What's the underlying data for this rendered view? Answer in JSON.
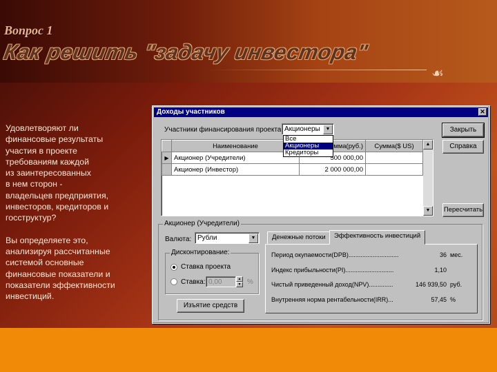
{
  "slide": {
    "pretitle": "Вопрос 1",
    "title": "Как решить \"задачу инвестора\"",
    "ornament": "☙",
    "paragraph1": "Удовлетворяют ли\nфинансовые результаты\nучастия в проекте\nтребованиям каждой\nиз заинтересованных\nв нем сторон -\nвладельцев предприятия,\nинвесторов, кредиторов и\nгосструктур?",
    "paragraph2": "Вы определяете это,\nанализируя рассчитанные\nсистемой основные\nфинансовые показатели и\nпоказатели эффективности\nинвестиций."
  },
  "dialog": {
    "title": "Доходы участников",
    "close_icon": "✕",
    "participants_label": "Участники финансирования проекта:",
    "participants_value": "Акционеры",
    "dropdown_options": [
      "Все",
      "Акционеры",
      "Кредиторы"
    ],
    "dropdown_selected": 1,
    "buttons": {
      "close": "Закрыть",
      "help": "Справка",
      "recalc": "Пересчитать",
      "withdraw": "Изъятие средств"
    },
    "table": {
      "headers": [
        "Наименование",
        "Сумма(руб.)",
        "Сумма($ US)"
      ],
      "rows": [
        {
          "name": "Акционер (Учредители)",
          "rub": "500 000,00",
          "usd": ""
        },
        {
          "name": "Акционер (Инвестор)",
          "rub": "2 000 000,00",
          "usd": ""
        }
      ]
    },
    "group_title": "Акционер (Учредители)",
    "currency_label": "Валюта:",
    "currency_value": "Рубли",
    "discount": {
      "title": "Дисконтирование:",
      "option1": "Ставка проекта",
      "option2": "Ставка:",
      "rate_value": "0,00",
      "rate_unit": "%"
    },
    "tabs": [
      "Денежные потоки",
      "Эффективность инвестиций"
    ],
    "active_tab": 1,
    "metrics": [
      {
        "label": "Период окупаемости(DPB).............................",
        "value": "36",
        "unit": "мес."
      },
      {
        "label": "Индекс прибыльности(PI)............................",
        "value": "1,10",
        "unit": ""
      },
      {
        "label": "Чистый приведенный доход(NPV)..............",
        "value": "146 939,50",
        "unit": "руб."
      },
      {
        "label": "Внутренняя норма рентабельности(IRR)...",
        "value": "57,45",
        "unit": "%"
      }
    ]
  },
  "colors": {
    "accent_band": "#f18a07",
    "title_bar": "#000080",
    "dialog_face": "#c0c0c0"
  }
}
